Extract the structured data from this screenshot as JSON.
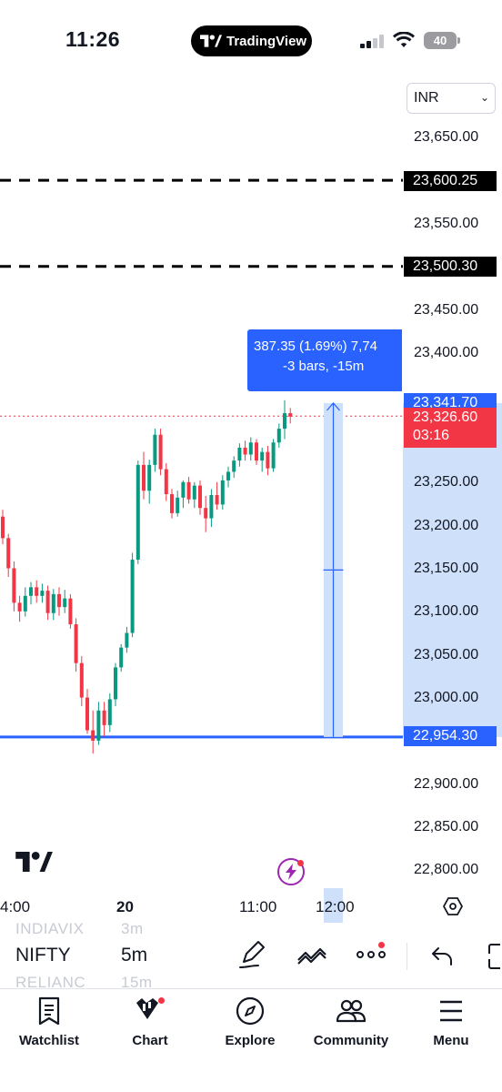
{
  "status_bar": {
    "time": "11:26",
    "battery": "40",
    "app_pill": "TradingView"
  },
  "currency": {
    "selected": "INR"
  },
  "price_axis": {
    "ticks": [
      "23,650.00",
      "23,550.00",
      "23,450.00",
      "23,400.00",
      "23,250.00",
      "23,200.00",
      "23,150.00",
      "23,100.00",
      "23,050.00",
      "23,000.00",
      "22,900.00",
      "22,850.00",
      "22,800.00"
    ],
    "levels": {
      "line_1": "23,600.25",
      "line_2": "23,500.30",
      "measure_top": "23,341.70",
      "last_price": "23,326.60",
      "countdown": "03:16",
      "support": "22,954.30"
    }
  },
  "measure": {
    "line1": "387.35 (1.69%) 7,74",
    "line2": "-3 bars, -15m"
  },
  "time_axis": {
    "ticks": [
      "4:00",
      "20",
      "11:00",
      "12:00"
    ]
  },
  "toolbar": {
    "ghost_above": {
      "symbol": "INDIAVIX",
      "interval": "3m"
    },
    "symbol": "NIFTY",
    "interval": "5m",
    "ghost_below": {
      "symbol": "RELIANC",
      "interval": "15m"
    }
  },
  "nav": {
    "watchlist": "Watchlist",
    "chart": "Chart",
    "explore": "Explore",
    "community": "Community",
    "menu": "Menu"
  },
  "colors": {
    "up": "#089981",
    "down": "#f23645",
    "accent": "#2962ff",
    "measure_fill": "#cfe0fb"
  },
  "chart_data": {
    "type": "candlestick",
    "symbol": "NIFTY",
    "interval": "5m",
    "candles": [
      {
        "o": 23210,
        "h": 23218,
        "l": 23178,
        "c": 23185
      },
      {
        "o": 23185,
        "h": 23190,
        "l": 23140,
        "c": 23150
      },
      {
        "o": 23150,
        "h": 23158,
        "l": 23100,
        "c": 23110
      },
      {
        "o": 23110,
        "h": 23118,
        "l": 23088,
        "c": 23100
      },
      {
        "o": 23100,
        "h": 23128,
        "l": 23094,
        "c": 23118
      },
      {
        "o": 23118,
        "h": 23134,
        "l": 23108,
        "c": 23128
      },
      {
        "o": 23128,
        "h": 23136,
        "l": 23110,
        "c": 23118
      },
      {
        "o": 23118,
        "h": 23132,
        "l": 23110,
        "c": 23124
      },
      {
        "o": 23124,
        "h": 23130,
        "l": 23090,
        "c": 23098
      },
      {
        "o": 23098,
        "h": 23126,
        "l": 23090,
        "c": 23120
      },
      {
        "o": 23120,
        "h": 23128,
        "l": 23095,
        "c": 23105
      },
      {
        "o": 23105,
        "h": 23125,
        "l": 23098,
        "c": 23115
      },
      {
        "o": 23115,
        "h": 23120,
        "l": 23080,
        "c": 23085
      },
      {
        "o": 23085,
        "h": 23092,
        "l": 23030,
        "c": 23040
      },
      {
        "o": 23040,
        "h": 23048,
        "l": 22990,
        "c": 23000
      },
      {
        "o": 23000,
        "h": 23010,
        "l": 22958,
        "c": 22962
      },
      {
        "o": 22962,
        "h": 22985,
        "l": 22935,
        "c": 22950
      },
      {
        "o": 22950,
        "h": 22995,
        "l": 22945,
        "c": 22985
      },
      {
        "o": 22985,
        "h": 22995,
        "l": 22955,
        "c": 22968
      },
      {
        "o": 22968,
        "h": 23005,
        "l": 22960,
        "c": 22998
      },
      {
        "o": 22998,
        "h": 23040,
        "l": 22990,
        "c": 23035
      },
      {
        "o": 23035,
        "h": 23062,
        "l": 23030,
        "c": 23058
      },
      {
        "o": 23058,
        "h": 23082,
        "l": 23052,
        "c": 23075
      },
      {
        "o": 23075,
        "h": 23168,
        "l": 23070,
        "c": 23160
      },
      {
        "o": 23160,
        "h": 23275,
        "l": 23155,
        "c": 23270
      },
      {
        "o": 23270,
        "h": 23285,
        "l": 23230,
        "c": 23240
      },
      {
        "o": 23240,
        "h": 23276,
        "l": 23225,
        "c": 23270
      },
      {
        "o": 23270,
        "h": 23312,
        "l": 23262,
        "c": 23305
      },
      {
        "o": 23305,
        "h": 23312,
        "l": 23258,
        "c": 23265
      },
      {
        "o": 23265,
        "h": 23272,
        "l": 23228,
        "c": 23236
      },
      {
        "o": 23236,
        "h": 23242,
        "l": 23208,
        "c": 23214
      },
      {
        "o": 23214,
        "h": 23240,
        "l": 23210,
        "c": 23232
      },
      {
        "o": 23232,
        "h": 23252,
        "l": 23220,
        "c": 23250
      },
      {
        "o": 23250,
        "h": 23256,
        "l": 23225,
        "c": 23230
      },
      {
        "o": 23230,
        "h": 23250,
        "l": 23220,
        "c": 23246
      },
      {
        "o": 23246,
        "h": 23252,
        "l": 23212,
        "c": 23220
      },
      {
        "o": 23220,
        "h": 23234,
        "l": 23192,
        "c": 23208
      },
      {
        "o": 23208,
        "h": 23242,
        "l": 23198,
        "c": 23235
      },
      {
        "o": 23235,
        "h": 23250,
        "l": 23218,
        "c": 23224
      },
      {
        "o": 23224,
        "h": 23258,
        "l": 23218,
        "c": 23252
      },
      {
        "o": 23252,
        "h": 23268,
        "l": 23244,
        "c": 23262
      },
      {
        "o": 23262,
        "h": 23280,
        "l": 23255,
        "c": 23275
      },
      {
        "o": 23275,
        "h": 23295,
        "l": 23268,
        "c": 23290
      },
      {
        "o": 23290,
        "h": 23298,
        "l": 23275,
        "c": 23282
      },
      {
        "o": 23282,
        "h": 23302,
        "l": 23275,
        "c": 23296
      },
      {
        "o": 23296,
        "h": 23300,
        "l": 23270,
        "c": 23275
      },
      {
        "o": 23275,
        "h": 23290,
        "l": 23262,
        "c": 23285
      },
      {
        "o": 23285,
        "h": 23292,
        "l": 23258,
        "c": 23266
      },
      {
        "o": 23266,
        "h": 23300,
        "l": 23262,
        "c": 23296
      },
      {
        "o": 23296,
        "h": 23318,
        "l": 23290,
        "c": 23312
      },
      {
        "o": 23312,
        "h": 23345,
        "l": 23300,
        "c": 23330
      },
      {
        "o": 23330,
        "h": 23336,
        "l": 23318,
        "c": 23326
      }
    ],
    "horizontal_lines": [
      23600.25,
      23500.3,
      22954.3
    ],
    "last_price": 23326.6,
    "measure": {
      "from": 22954.3,
      "to": 23341.7
    },
    "ylim": [
      22770,
      23705
    ]
  }
}
